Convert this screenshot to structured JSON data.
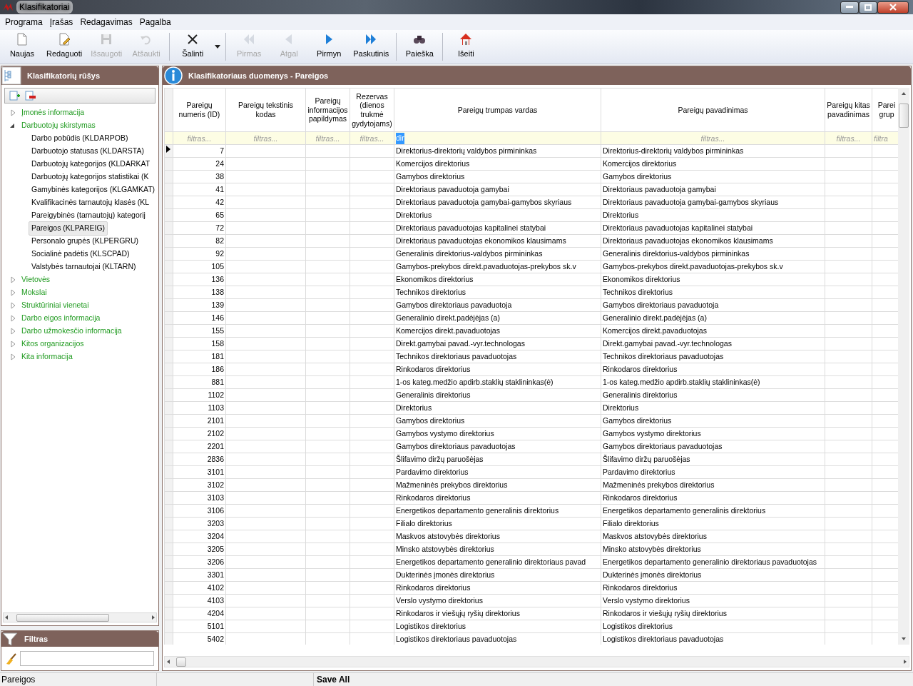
{
  "window": {
    "title": "Klasifikatoriai"
  },
  "menu": [
    "Programa",
    "Įrašas",
    "Redagavimas",
    "Pagalba"
  ],
  "toolbar_groups": [
    [
      {
        "label": "Naujas",
        "disabled": false
      },
      {
        "label": "Redaguoti",
        "disabled": false
      },
      {
        "label": "Išsaugoti",
        "disabled": true
      },
      {
        "label": "Atšaukti",
        "disabled": true
      }
    ],
    [
      {
        "label": "Šalinti",
        "disabled": false,
        "has_menu": true
      }
    ],
    [
      {
        "label": "Pirmas",
        "disabled": true
      },
      {
        "label": "Atgal",
        "disabled": true
      },
      {
        "label": "Pirmyn",
        "disabled": false
      },
      {
        "label": "Paskutinis",
        "disabled": false
      }
    ],
    [
      {
        "label": "Paieška",
        "disabled": false
      }
    ],
    [
      {
        "label": "Išeiti",
        "disabled": false
      }
    ]
  ],
  "tree": {
    "title": "Klasifikatorių rūšys",
    "items": [
      {
        "label": "Įmonės informacija",
        "expanded": false,
        "selected": false
      },
      {
        "label": "Darbuotojų skirstymas",
        "expanded": true,
        "selected": false,
        "children": [
          {
            "label": "Darbo pobūdis (KLDARPOB)",
            "selected": false
          },
          {
            "label": "Darbuotojo statusas (KLDARSTA)",
            "selected": false
          },
          {
            "label": "Darbuotojų kategorijos (KLDARKAT",
            "selected": false
          },
          {
            "label": "Darbuotojų kategorijos statistikai (K",
            "selected": false
          },
          {
            "label": "Gamybinės kategorijos (KLGAMKAT)",
            "selected": false
          },
          {
            "label": "Kvalifikacinės tarnautojų klasės (KL",
            "selected": false
          },
          {
            "label": "Pareigybinės (tarnautojų) kategorij",
            "selected": false
          },
          {
            "label": "Pareigos (KLPAREIG)",
            "selected": true
          },
          {
            "label": "Personalo grupės (KLPERGRU)",
            "selected": false
          },
          {
            "label": "Socialinė padėtis (KLSCPAD)",
            "selected": false
          },
          {
            "label": "Valstybės tarnautojai (KLTARN)",
            "selected": false
          }
        ]
      },
      {
        "label": "Vietovės",
        "expanded": false,
        "selected": false
      },
      {
        "label": "Mokslai",
        "expanded": false,
        "selected": false
      },
      {
        "label": "Struktūriniai vienetai",
        "expanded": false,
        "selected": false
      },
      {
        "label": "Darbo eigos informacija",
        "expanded": false,
        "selected": false
      },
      {
        "label": "Darbo užmokesčio informacija",
        "expanded": false,
        "selected": false
      },
      {
        "label": "Kitos organizacijos",
        "expanded": false,
        "selected": false
      },
      {
        "label": "Kita informacija",
        "expanded": false,
        "selected": false
      }
    ]
  },
  "filter_panel": {
    "title": "Filtras"
  },
  "grid": {
    "title": "Klasifikatoriaus duomenys - Pareigos",
    "columns": [
      {
        "header": "Pareigų numeris (ID)",
        "filter_placeholder": "filtras..."
      },
      {
        "header": "Pareigų tekstinis kodas",
        "filter_placeholder": "filtras..."
      },
      {
        "header": "Pareigų informacijos papildymas",
        "filter_placeholder": "filtras..."
      },
      {
        "header": "Rezervas (dienos trukmė gydytojams)",
        "filter_placeholder": "filtras..."
      },
      {
        "header": "Pareigų trumpas vardas",
        "filter_value": "dir"
      },
      {
        "header": "Pareigų pavadinimas",
        "filter_placeholder": "filtras..."
      },
      {
        "header": "Pareigų kitas pavadinimas",
        "filter_placeholder": "filtras..."
      },
      {
        "header": "Parei grup",
        "filter_placeholder": "filtra"
      }
    ],
    "rows": [
      {
        "id": "7",
        "short_name": "Direktorius-direktorių valdybos pirmininkas",
        "name": "Direktorius-direktorių valdybos pirmininkas",
        "current": true
      },
      {
        "id": "24",
        "short_name": "Komercijos direktorius",
        "name": "Komercijos direktorius",
        "current": false
      },
      {
        "id": "38",
        "short_name": "Gamybos direktorius",
        "name": "Gamybos direktorius",
        "current": false
      },
      {
        "id": "41",
        "short_name": "Direktoriaus pavaduotoja gamybai",
        "name": "Direktoriaus pavaduotoja gamybai",
        "current": false
      },
      {
        "id": "42",
        "short_name": "Direktoriaus pavaduotoja gamybai-gamybos skyriaus",
        "name": "Direktoriaus pavaduotoja gamybai-gamybos skyriaus",
        "current": false
      },
      {
        "id": "65",
        "short_name": "Direktorius",
        "name": "Direktorius",
        "current": false
      },
      {
        "id": "72",
        "short_name": "Direktoriaus pavaduotojas kapitalinei statybai",
        "name": "Direktoriaus pavaduotojas kapitalinei statybai",
        "current": false
      },
      {
        "id": "82",
        "short_name": "Direktoriaus pavaduotojas ekonomikos klausimams",
        "name": "Direktoriaus pavaduotojas ekonomikos klausimams",
        "current": false
      },
      {
        "id": "92",
        "short_name": "Generalinis direktorius-valdybos pirmininkas",
        "name": "Generalinis direktorius-valdybos pirmininkas",
        "current": false
      },
      {
        "id": "105",
        "short_name": "Gamybos-prekybos direkt.pavaduotojas-prekybos sk.v",
        "name": "Gamybos-prekybos direkt.pavaduotojas-prekybos sk.v",
        "current": false
      },
      {
        "id": "136",
        "short_name": "Ekonomikos direktorius",
        "name": "Ekonomikos direktorius",
        "current": false
      },
      {
        "id": "138",
        "short_name": "Technikos direktorius",
        "name": "Technikos direktorius",
        "current": false
      },
      {
        "id": "139",
        "short_name": "Gamybos direktoriaus pavaduotoja",
        "name": "Gamybos direktoriaus pavaduotoja",
        "current": false
      },
      {
        "id": "146",
        "short_name": "Generalinio direkt.padėjėjas (a)",
        "name": "Generalinio direkt.padėjėjas (a)",
        "current": false
      },
      {
        "id": "155",
        "short_name": "Komercijos direkt.pavaduotojas",
        "name": "Komercijos direkt.pavaduotojas",
        "current": false
      },
      {
        "id": "158",
        "short_name": "Direkt.gamybai pavad.-vyr.technologas",
        "name": "Direkt.gamybai pavad.-vyr.technologas",
        "current": false
      },
      {
        "id": "181",
        "short_name": "Technikos direktoriaus pavaduotojas",
        "name": "Technikos direktoriaus pavaduotojas",
        "current": false
      },
      {
        "id": "186",
        "short_name": "Rinkodaros direktorius",
        "name": "Rinkodaros direktorius",
        "current": false
      },
      {
        "id": "881",
        "short_name": "1-os kateg.medžio apdirb.staklių staklininkas(ė)",
        "name": "1-os kateg.medžio apdirb.staklių staklininkas(ė)",
        "current": false
      },
      {
        "id": "1102",
        "short_name": "Generalinis direktorius",
        "name": "Generalinis direktorius",
        "current": false
      },
      {
        "id": "1103",
        "short_name": "Direktorius",
        "name": "Direktorius",
        "current": false
      },
      {
        "id": "2101",
        "short_name": "Gamybos direktorius",
        "name": "Gamybos direktorius",
        "current": false
      },
      {
        "id": "2102",
        "short_name": "Gamybos vystymo direktorius",
        "name": "Gamybos vystymo direktorius",
        "current": false
      },
      {
        "id": "2201",
        "short_name": "Gamybos direktoriaus pavaduotojas",
        "name": "Gamybos direktoriaus pavaduotojas",
        "current": false
      },
      {
        "id": "2836",
        "short_name": "Šlifavimo diržų paruošėjas",
        "name": "Šlifavimo diržų paruošėjas",
        "current": false
      },
      {
        "id": "3101",
        "short_name": "Pardavimo direktorius",
        "name": "Pardavimo direktorius",
        "current": false
      },
      {
        "id": "3102",
        "short_name": "Mažmeninės prekybos direktorius",
        "name": "Mažmeninės prekybos direktorius",
        "current": false
      },
      {
        "id": "3103",
        "short_name": "Rinkodaros direktorius",
        "name": "Rinkodaros direktorius",
        "current": false
      },
      {
        "id": "3106",
        "short_name": "Energetikos departamento generalinis direktorius",
        "name": "Energetikos departamento generalinis direktorius",
        "current": false
      },
      {
        "id": "3203",
        "short_name": "Filialo direktorius",
        "name": "Filialo direktorius",
        "current": false
      },
      {
        "id": "3204",
        "short_name": "Maskvos atstovybės direktorius",
        "name": "Maskvos atstovybės direktorius",
        "current": false
      },
      {
        "id": "3205",
        "short_name": "Minsko atstovybės direktorius",
        "name": "Minsko atstovybės direktorius",
        "current": false
      },
      {
        "id": "3206",
        "short_name": "Energetikos departamento generalinio direktoriaus pavad",
        "name": "Energetikos departamento generalinio direktoriaus pavaduotojas",
        "current": false
      },
      {
        "id": "3301",
        "short_name": "Dukterinės įmonės direktorius",
        "name": "Dukterinės įmonės direktorius",
        "current": false
      },
      {
        "id": "4102",
        "short_name": "Rinkodaros direktorius",
        "name": "Rinkodaros direktorius",
        "current": false
      },
      {
        "id": "4103",
        "short_name": "Verslo vystymo direktorius",
        "name": "Verslo vystymo direktorius",
        "current": false
      },
      {
        "id": "4204",
        "short_name": "Rinkodaros ir viešųjų ryšių direktorius",
        "name": "Rinkodaros ir viešųjų ryšių direktorius",
        "current": false
      },
      {
        "id": "5101",
        "short_name": "Logistikos direktorius",
        "name": "Logistikos direktorius",
        "current": false
      },
      {
        "id": "5402",
        "short_name": "Logistikos direktoriaus pavaduotojas",
        "name": "Logistikos direktoriaus pavaduotojas",
        "current": false
      }
    ]
  },
  "status_bar": [
    "Pareigos",
    "Save All"
  ]
}
